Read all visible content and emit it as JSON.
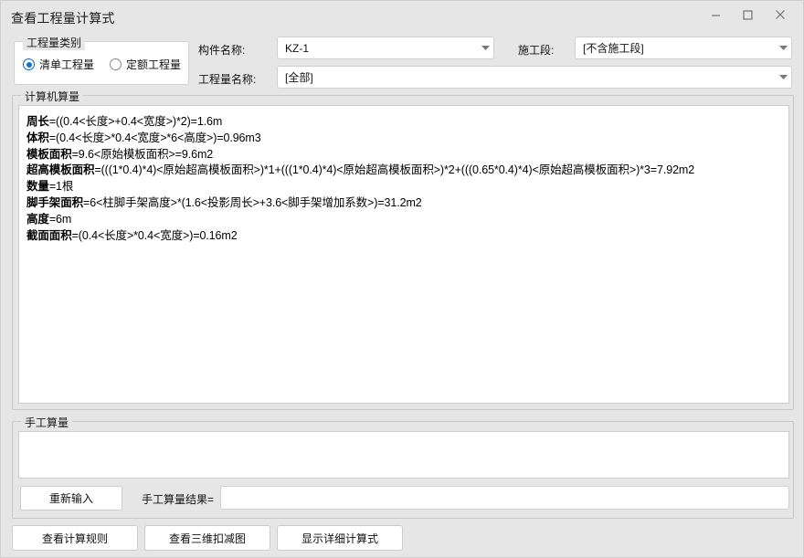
{
  "window": {
    "title": "查看工程量计算式",
    "controls": {
      "minimize": "minimize-icon",
      "maximize": "maximize-icon",
      "close": "close-icon"
    }
  },
  "category_group": {
    "title": "工程量类别",
    "options": [
      {
        "label": "清单工程量",
        "checked": true
      },
      {
        "label": "定额工程量",
        "checked": false
      }
    ]
  },
  "fields": {
    "component_label": "构件名称:",
    "component_value": "KZ-1",
    "section_label": "施工段:",
    "section_value": "[不含施工段]",
    "quantity_label": "工程量名称:",
    "quantity_value": "[全部]"
  },
  "computer_calc": {
    "title": "计算机算量",
    "lines": [
      {
        "name": "周长",
        "expr": "=((0.4<长度>+0.4<宽度>)*2)=1.6m"
      },
      {
        "name": "体积",
        "expr": "=(0.4<长度>*0.4<宽度>*6<高度>)=0.96m3"
      },
      {
        "name": "模板面积",
        "expr": "=9.6<原始模板面积>=9.6m2"
      },
      {
        "name": "超高模板面积",
        "expr": "=(((1*0.4)*4)<原始超高模板面积>)*1+(((1*0.4)*4)<原始超高模板面积>)*2+(((0.65*0.4)*4)<原始超高模板面积>)*3=7.92m2"
      },
      {
        "name": "数量",
        "expr": "=1根"
      },
      {
        "name": "脚手架面积",
        "expr": "=6<柱脚手架高度>*(1.6<投影周长>+3.6<脚手架增加系数>)=31.2m2"
      },
      {
        "name": "高度",
        "expr": "=6m"
      },
      {
        "name": "截面面积",
        "expr": "=(0.4<长度>*0.4<宽度>)=0.16m2"
      }
    ]
  },
  "manual_calc": {
    "title": "手工算量",
    "textarea_value": "",
    "reinput_button": "重新输入",
    "result_label": "手工算量结果=",
    "result_value": ""
  },
  "bottom_buttons": {
    "rules": "查看计算规则",
    "view3d": "查看三维扣减图",
    "detail": "显示详细计算式"
  },
  "colors": {
    "window_bg": "#e6e6e6",
    "panel_bg": "#ffffff",
    "border": "#cccccc",
    "accent": "#1272d4",
    "text": "#111111"
  }
}
